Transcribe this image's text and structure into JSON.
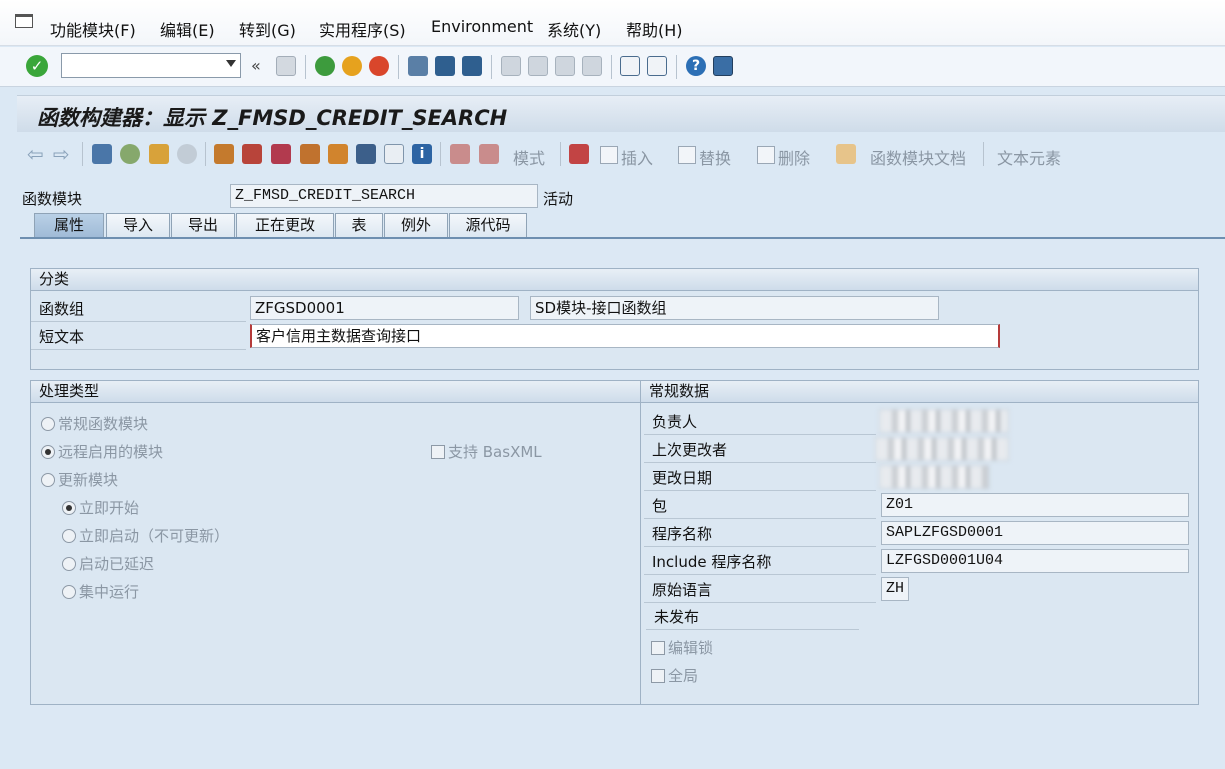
{
  "menu": {
    "items": [
      "功能模块(F)",
      "编辑(E)",
      "转到(G)",
      "实用程序(S)",
      "Environment",
      "系统(Y)",
      "帮助(H)"
    ]
  },
  "toolbar": {
    "command_field_value": "",
    "back_glyph": "«"
  },
  "title": "函数构建器：显示 Z_FMSD_CREDIT_SEARCH",
  "app_toolbar": {
    "pattern_label": "模式",
    "insert_label": "插入",
    "replace_label": "替换",
    "delete_label": "删除",
    "fm_doc_label": "函数模块文档",
    "text_elements_label": "文本元素"
  },
  "header": {
    "fm_label": "函数模块",
    "fm_value": "Z_FMSD_CREDIT_SEARCH",
    "status": "活动"
  },
  "tabs": [
    "属性",
    "导入",
    "导出",
    "正在更改",
    "表",
    "例外",
    "源代码"
  ],
  "active_tab": "属性",
  "classification": {
    "title": "分类",
    "function_group_label": "函数组",
    "function_group_value": "ZFGSD0001",
    "function_group_desc": "SD模块-接口函数组",
    "short_text_label": "短文本",
    "short_text_value": "客户信用主数据查询接口"
  },
  "processing_type": {
    "title": "处理类型",
    "normal": "常规函数模块",
    "remote": "远程启用的模块",
    "basxml": "支持 BasXML",
    "update": "更新模块",
    "immediate_start": "立即开始",
    "immediate_start_no_update": "立即启动（不可更新）",
    "start_delayed": "启动已延迟",
    "collective_run": "集中运行",
    "selected": "远程启用的模块",
    "update_selected": "立即开始"
  },
  "general_data": {
    "title": "常规数据",
    "person_responsible_label": "负责人",
    "last_changed_by_label": "上次更改者",
    "changed_on_label": "更改日期",
    "package_label": "包",
    "package_value": "Z01",
    "program_name_label": "程序名称",
    "program_name_value": "SAPLZFGSD0001",
    "include_label": "Include 程序名称",
    "include_value": "LZFGSD0001U04",
    "original_language_label": "原始语言",
    "original_language_value": "ZH",
    "not_released": "未发布",
    "edit_lock": "编辑锁",
    "global": "全局"
  },
  "colors": {
    "background": "#dbe8f4",
    "active_tab": "#a9c3de",
    "ok_icon": "#3aa63a"
  }
}
